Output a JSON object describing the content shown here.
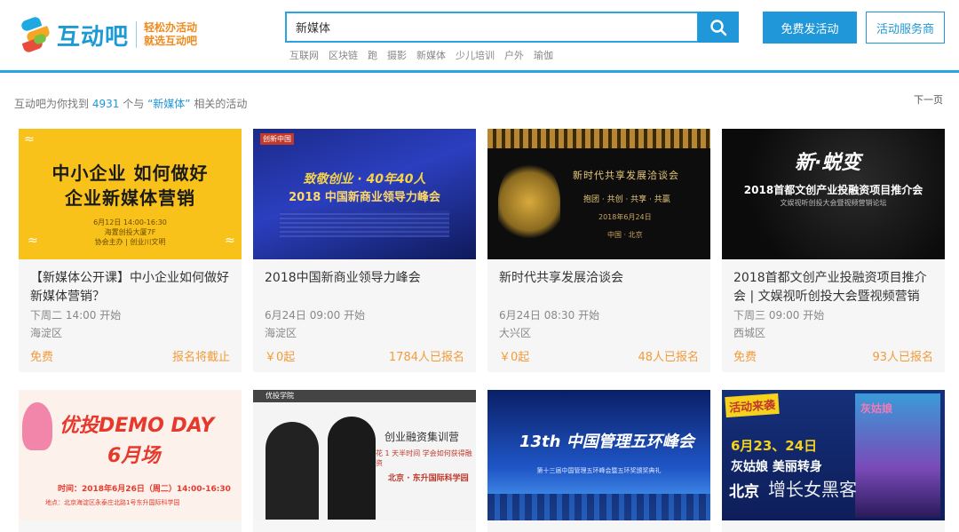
{
  "header": {
    "logo_text": "互动吧",
    "slogan_line1": "轻松办活动",
    "slogan_line2": "就选互动吧",
    "search_value": "新媒体",
    "hot_tags": [
      "互联网",
      "区块链",
      "跑",
      "摄影",
      "新媒体",
      "少儿培训",
      "户外",
      "瑜伽"
    ],
    "publish_label": "免费发活动",
    "service_label": "活动服务商"
  },
  "results": {
    "prefix": "互动吧为你找到",
    "count": "4931",
    "middle": "个与",
    "keyword": "“新媒体”",
    "suffix": "相关的活动",
    "next_page": "下一页"
  },
  "cards": [
    {
      "title": "【新媒体公开课】中小企业如何做好新媒体营销？",
      "time": "下周二 14:00 开始",
      "location": "海淀区",
      "price": "免费",
      "status": "报名将截止",
      "art": {
        "big1": "中小企业 如何做好",
        "big2": "企业新媒体营销",
        "small1": "6月12日 14:00-16:30",
        "small2": "海置创投大厦7F",
        "small3": "协会主办 | 创业川文明"
      }
    },
    {
      "title": "2018中国新商业领导力峰会",
      "time": "6月24日 09:00 开始",
      "location": "海淀区",
      "price": "￥0起",
      "status": "1784人已报名",
      "art": {
        "tag": "创新中国",
        "head": "致敬创业 · 40年40人",
        "main": "2018 中国新商业领导力峰会"
      }
    },
    {
      "title": "新时代共享发展洽谈会",
      "time": "6月24日 08:30 开始",
      "location": "大兴区",
      "price": "￥0起",
      "status": "48人已报名",
      "art": {
        "title": "新时代共享发展洽谈会",
        "sub": "抱团 · 共创 · 共享 · 共赢",
        "date": "2018年6月24日",
        "city": "中国 · 北京"
      }
    },
    {
      "title": "2018首都文创产业投融资项目推介会 | 文娱视听创投大会暨视频营销",
      "time": "下周三 09:00 开始",
      "location": "西城区",
      "price": "免费",
      "status": "93人已报名",
      "art": {
        "calligraphy": "新·蜕变",
        "main": "2018首都文创产业投融资项目推介会",
        "sub": "文娱视听创投大会暨视频营销论坛"
      }
    },
    {
      "art": {
        "line1": "优投DEMO DAY",
        "line2": "6月场",
        "time": "时间：2018年6月26日（周二）14:00-16:30",
        "place": "地点：北京海淀区永泰庄北路1号东升国际科学园"
      }
    },
    {
      "art": {
        "brand": "优投学院",
        "title": "创业融资集训营",
        "sub": "花 1 天半时间  学会如何获得融资",
        "loc": "北京 · 东升国际科学园"
      }
    },
    {
      "art": {
        "main": "13th 中国管理五环峰会",
        "sub": "第十三届中国管理五环峰会暨五环奖颁奖典礼"
      }
    },
    {
      "art": {
        "badge": "活动来袭",
        "date": "6月23、24日",
        "line2": "灰姑娘  美丽转身",
        "line3": "北京",
        "poster_title": "灰姑娘",
        "watermark": "增长女黑客"
      }
    }
  ],
  "colors": {
    "accent": "#1f97d9",
    "price": "#f39b3b",
    "header_rule": "#29a3e3"
  }
}
